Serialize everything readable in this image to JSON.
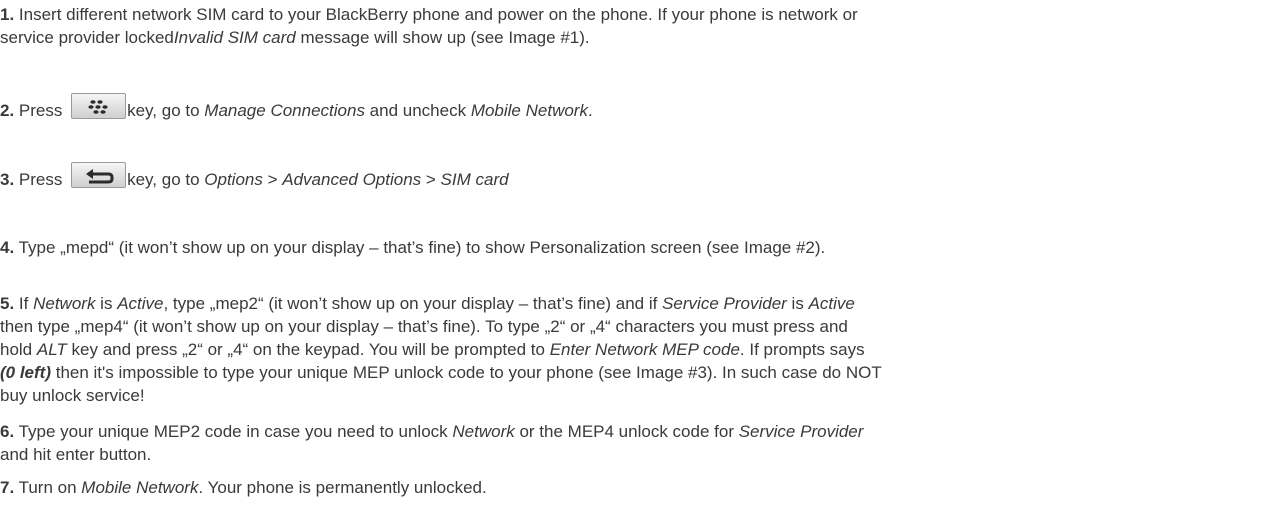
{
  "steps": [
    {
      "num": "1.",
      "line1": " Insert different network SIM card to your BlackBerry phone and power on the phone. If your phone is network or",
      "line2a": "service provider locked",
      "line2em": "Invalid SIM card",
      "line2b": " message will show up (see Image #1)."
    },
    {
      "num": "2.",
      "pre": " Press ",
      "key_icon": "blackberry-menu-key-icon",
      "a": "key, go to ",
      "em1": "Manage Connections",
      "b": " and uncheck ",
      "em2": "Mobile Network",
      "c": "."
    },
    {
      "num": "3.",
      "pre": " Press ",
      "key_icon": "back-escape-key-icon",
      "a": "key, go to ",
      "em1": "Options",
      "b": " > ",
      "em2": "Advanced Options",
      "c": " > ",
      "em3": "SIM card"
    },
    {
      "num": "4.",
      "text": " Type „mepd“ (it won’t show up on your display – that’s fine) to show Personalization screen (see Image #2)."
    },
    {
      "num": "5.",
      "l1a": " If ",
      "l1em1": "Network",
      "l1b": " is ",
      "l1em2": "Active",
      "l1c": ", type „mep2“ (it won’t show up on your display – that’s fine) and if ",
      "l1em3": "Service Provider",
      "l1d": " is ",
      "l1em4": "Active",
      "l2": "then type „mep4“ (it won’t show up on your display – that’s fine). To type „2“ or „4“ characters you must press and",
      "l3a": "hold ",
      "l3em1": "ALT",
      "l3b": " key and press „2“ or „4“ on the keypad. You will be prompted to ",
      "l3em2": "Enter Network MEP code",
      "l3c": ". If prompts says",
      "l4em": "(0 left)",
      "l4b": " then it's impossible to type your unique MEP unlock code to your phone (see Image #3). In such case do NOT",
      "l5": "buy unlock service!"
    },
    {
      "num": "6.",
      "l1a": " Type your unique MEP2 code in case you need to unlock ",
      "l1em1": "Network",
      "l1b": " or the MEP4 unlock code for ",
      "l1em2": "Service Provider",
      "l2": "and hit enter button."
    },
    {
      "num": "7.",
      "a": " Turn on ",
      "em": "Mobile Network",
      "b": ". Your phone is permanently unlocked."
    }
  ]
}
